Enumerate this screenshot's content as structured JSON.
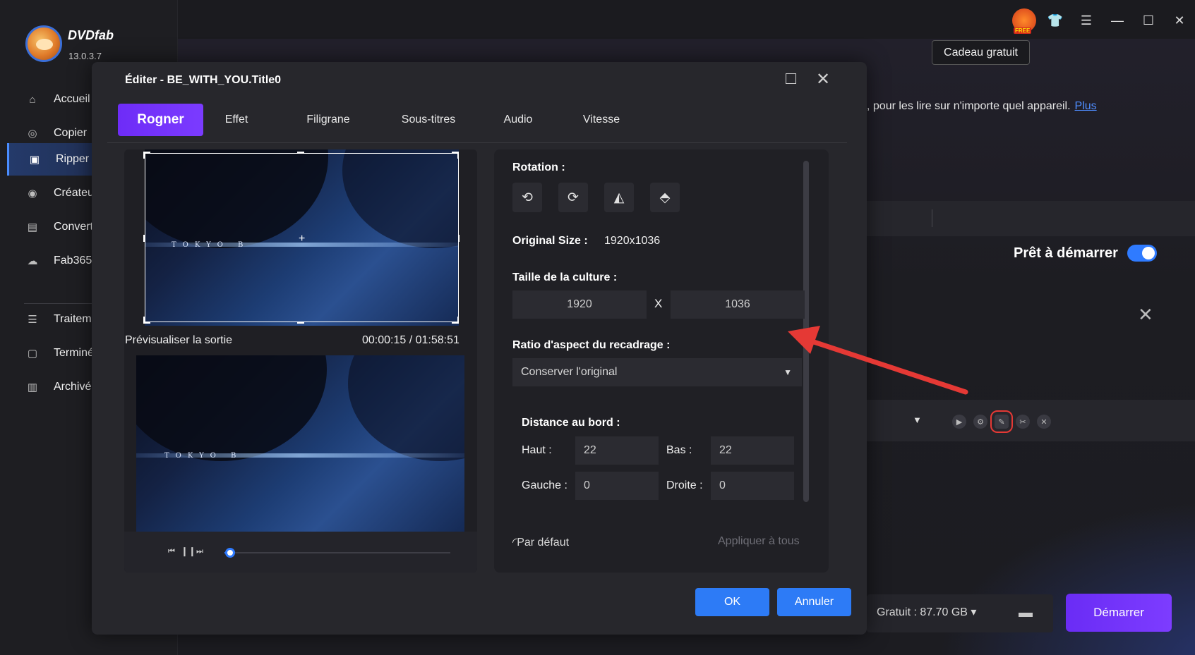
{
  "app": {
    "brand": "DVDfab",
    "version": "13.0.3.7"
  },
  "sidebar": {
    "items": [
      {
        "label": "Accueil",
        "icon": "home-icon"
      },
      {
        "label": "Copier",
        "icon": "disc-icon"
      },
      {
        "label": "Ripper",
        "icon": "ripper-icon"
      },
      {
        "label": "Créateur",
        "icon": "creator-icon"
      },
      {
        "label": "Converti",
        "icon": "film-icon"
      },
      {
        "label": "Fab365",
        "icon": "cloud-icon"
      },
      {
        "label": "Traitement",
        "icon": "list-icon"
      },
      {
        "label": "Terminé",
        "icon": "clipboard-icon"
      },
      {
        "label": "Archivé",
        "icon": "archive-icon"
      }
    ]
  },
  "topbar": {
    "gift_label": "Cadeau gratuit"
  },
  "background": {
    "description": ", pour les lire sur n'importe quel appareil.",
    "more_link": "Plus",
    "ready_label": "Prêt à démarrer",
    "free_space": "Gratuit : 87.70 GB",
    "start_label": "Démarrer"
  },
  "dialog": {
    "title": "Éditer - BE_WITH_YOU.Title0",
    "tabs": [
      "Rogner",
      "Effet",
      "Filigrane",
      "Sous-titres",
      "Audio",
      "Vitesse"
    ],
    "active_tab": "Rogner",
    "preview": {
      "label": "Prévisualiser la sortie",
      "timecode": "00:00:15 / 01:58:51",
      "progress": 0.002
    },
    "settings": {
      "rotation_label": "Rotation :",
      "original_size_label": "Original Size :",
      "original_size_value": "1920x1036",
      "crop_size_label": "Taille de la culture :",
      "crop_width": "1920",
      "crop_height": "1036",
      "crop_sep": "X",
      "aspect_label": "Ratio d'aspect du recadrage :",
      "aspect_value": "Conserver l'original",
      "edge_label": "Distance au bord :",
      "top_label": "Haut :",
      "top_value": "22",
      "bottom_label": "Bas :",
      "bottom_value": "22",
      "left_label": "Gauche :",
      "left_value": "0",
      "right_label": "Droite :",
      "right_value": "0",
      "reset_label": "Par défaut",
      "apply_all_label": "Appliquer à tous"
    },
    "ok_label": "OK",
    "cancel_label": "Annuler"
  },
  "colors": {
    "accent_purple": "#7b3bff",
    "button_blue": "#2d7bf6",
    "annotation_red": "#e53935"
  }
}
